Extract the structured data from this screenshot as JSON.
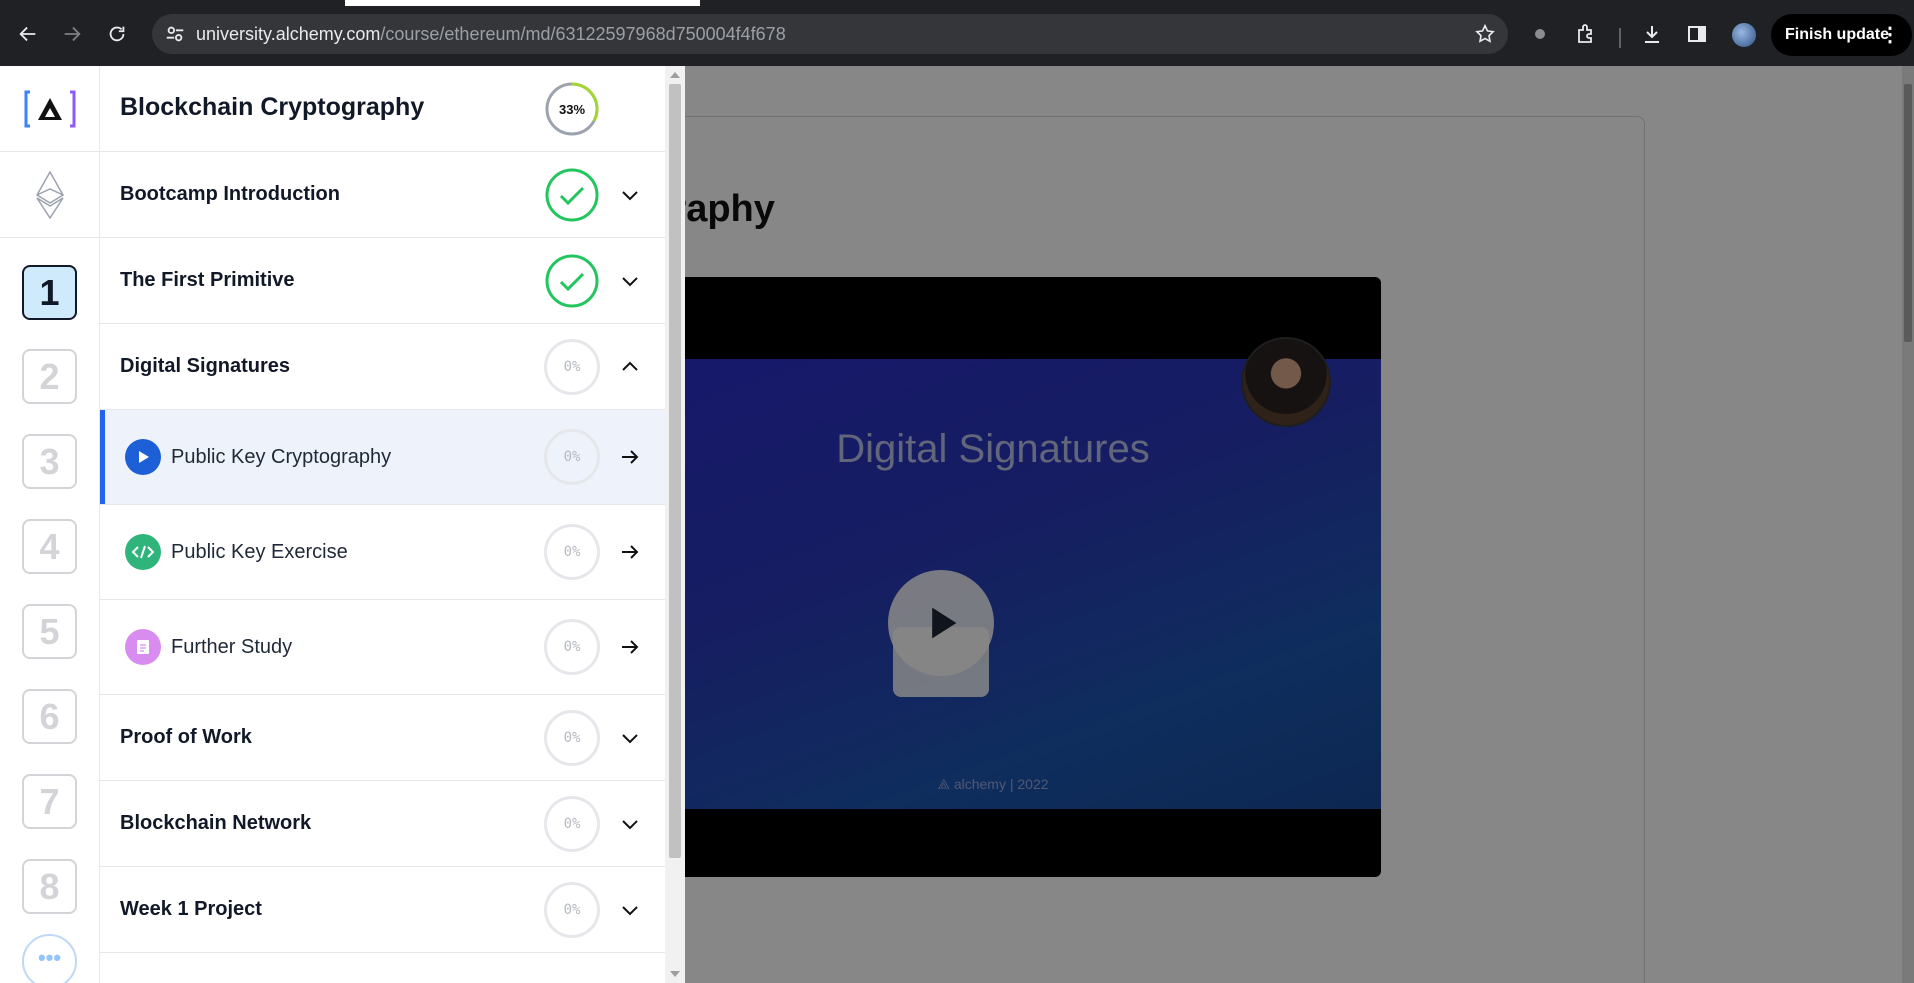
{
  "browser": {
    "url_host": "university.alchemy.com",
    "url_path": "/course/ethereum/md/63122597968d750004f4f678",
    "finish_update_label": "Finish update",
    "menu_glyph": "⋮"
  },
  "rail": {
    "weeks": [
      "1",
      "2",
      "3",
      "4",
      "5",
      "6",
      "7",
      "8"
    ],
    "active_week": "1",
    "more_label": "•••"
  },
  "sidebar": {
    "course_title": "Blockchain Cryptography",
    "course_progress": "33%",
    "course_progress_value": 0.33,
    "sections": [
      {
        "label": "Bootcamp Introduction",
        "status": "complete"
      },
      {
        "label": "The First Primitive",
        "status": "complete"
      },
      {
        "label": "Digital Signatures",
        "status": "expanded",
        "progress": "0%"
      },
      {
        "label": "Proof of Work",
        "progress": "0%"
      },
      {
        "label": "Blockchain Network",
        "progress": "0%"
      },
      {
        "label": "Week 1 Project",
        "progress": "0%"
      }
    ],
    "lessons": [
      {
        "label": "Public Key Cryptography",
        "type": "video",
        "progress": "0%",
        "active": true
      },
      {
        "label": "Public Key Exercise",
        "type": "code",
        "progress": "0%"
      },
      {
        "label": "Further Study",
        "type": "document",
        "progress": "0%"
      }
    ]
  },
  "main": {
    "heading_visible": "ography",
    "video": {
      "slide_title": "Digital Signatures",
      "slide_footer_brand": "alchemy",
      "slide_footer_year": "2022"
    }
  },
  "colors": {
    "complete": "#22c55e",
    "accent": "#2563eb",
    "active_row": "#eef2fb",
    "code_icon": "#2fb47c",
    "doc_icon": "#d98cf0"
  }
}
